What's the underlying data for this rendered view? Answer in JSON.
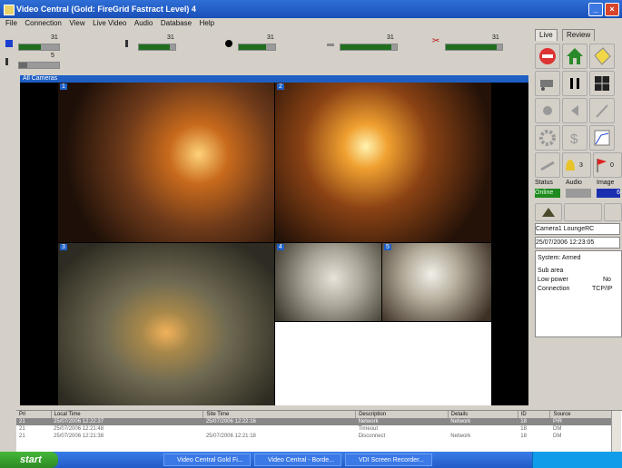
{
  "window": {
    "title": "Video Central (Gold: FireGrid Fastract Level) 4"
  },
  "menu": [
    "File",
    "Connection",
    "View",
    "Live Video",
    "Audio",
    "Database",
    "Help"
  ],
  "meters": [
    {
      "id": "m1",
      "label": "31",
      "level": 0.55
    },
    {
      "id": "m2",
      "label": "5",
      "level": 0.2
    },
    {
      "id": "m3",
      "label": "31",
      "level": 0.85
    },
    {
      "id": "m4",
      "label": "31",
      "level": 0.75
    },
    {
      "id": "m5",
      "label": "31",
      "level": 0.9
    },
    {
      "id": "m6",
      "label": "31",
      "level": 0.9
    }
  ],
  "camera_panel": {
    "header": "All Cameras",
    "cameras": [
      "1",
      "2",
      "3",
      "4",
      "5"
    ]
  },
  "right_panel": {
    "tabs": [
      "Live",
      "Review"
    ],
    "status_labels": {
      "status": "Status",
      "audio": "Audio",
      "image": "Image"
    },
    "status_value": "Online",
    "image_value": "6",
    "camera_select": "Camera1 LoungeRC",
    "datetime": "25/07/2006 12:23:05",
    "info": [
      {
        "k": "System: Armed",
        "v": ""
      },
      {
        "k": "Sub area",
        "v": ""
      },
      {
        "k": "Low power",
        "v": "No"
      },
      {
        "k": "Connection",
        "v": "TCP/IP"
      }
    ],
    "counters": {
      "bell": "3",
      "flag": "0"
    }
  },
  "events": {
    "headers": [
      "Pri",
      "Local Time",
      "Site Time",
      "Description",
      "Details",
      "ID",
      "Source"
    ],
    "rows": [
      [
        "21",
        "25/07/2006 12:22:37",
        "25/07/2006 12:22:16",
        "Network",
        "Network",
        "18",
        "PIR"
      ],
      [
        "21",
        "25/07/2006 12:21:48",
        "",
        "Timeout",
        "",
        "18",
        "DM"
      ],
      [
        "21",
        "25/07/2006 12:21:38",
        "25/07/2006 12:21:18",
        "Disconnect",
        "Network",
        "18",
        "DM"
      ]
    ]
  },
  "taskbar": {
    "start": "start",
    "tasks": [
      "Video Central Gold Fi...",
      "Video Central - Borde...",
      "VDI Screen Recorder..."
    ]
  }
}
